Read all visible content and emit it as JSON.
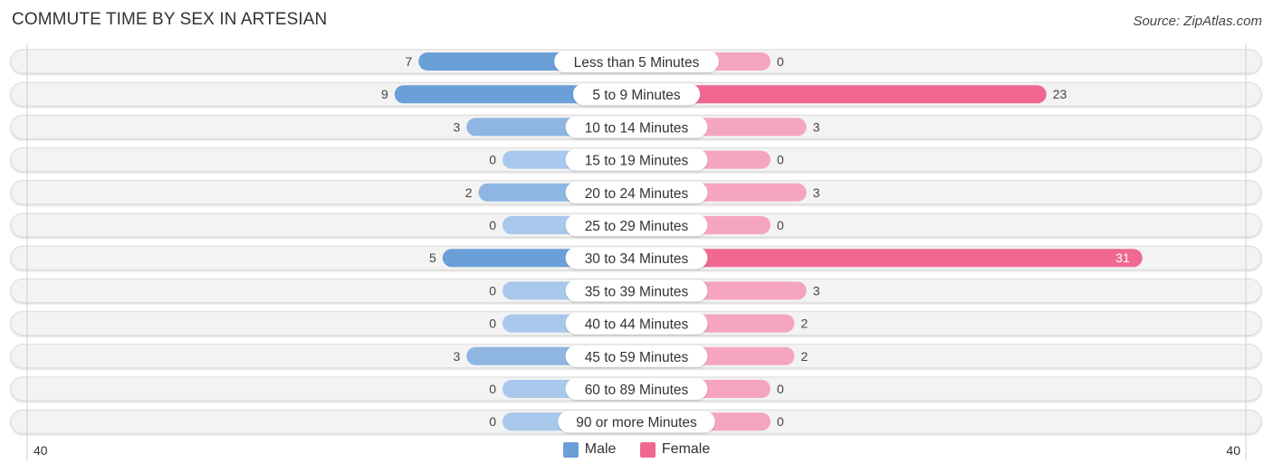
{
  "header": {
    "title": "COMMUTE TIME BY SEX IN ARTESIAN",
    "source": "Source: ZipAtlas.com"
  },
  "colors": {
    "male": "#6a9fd8",
    "male_light": "#a8c8ec",
    "female": "#f06890",
    "female_light": "#f5a6be",
    "track": "#f3f3f3"
  },
  "chart_data": {
    "type": "bar",
    "orientation": "horizontal-diverging",
    "title": "COMMUTE TIME BY SEX IN ARTESIAN",
    "categories": [
      "Less than 5 Minutes",
      "5 to 9 Minutes",
      "10 to 14 Minutes",
      "15 to 19 Minutes",
      "20 to 24 Minutes",
      "25 to 29 Minutes",
      "30 to 34 Minutes",
      "35 to 39 Minutes",
      "40 to 44 Minutes",
      "45 to 59 Minutes",
      "60 to 89 Minutes",
      "90 or more Minutes"
    ],
    "series": [
      {
        "name": "Male",
        "values": [
          7,
          9,
          3,
          0,
          2,
          0,
          5,
          0,
          0,
          3,
          0,
          0
        ]
      },
      {
        "name": "Female",
        "values": [
          0,
          23,
          3,
          0,
          3,
          0,
          31,
          3,
          2,
          2,
          0,
          0
        ]
      }
    ],
    "axis": {
      "left_label": "40",
      "right_label": "40",
      "range": [
        -40,
        40
      ]
    },
    "legend": {
      "position": "bottom-center",
      "entries": [
        "Male",
        "Female"
      ]
    },
    "grid": false
  }
}
